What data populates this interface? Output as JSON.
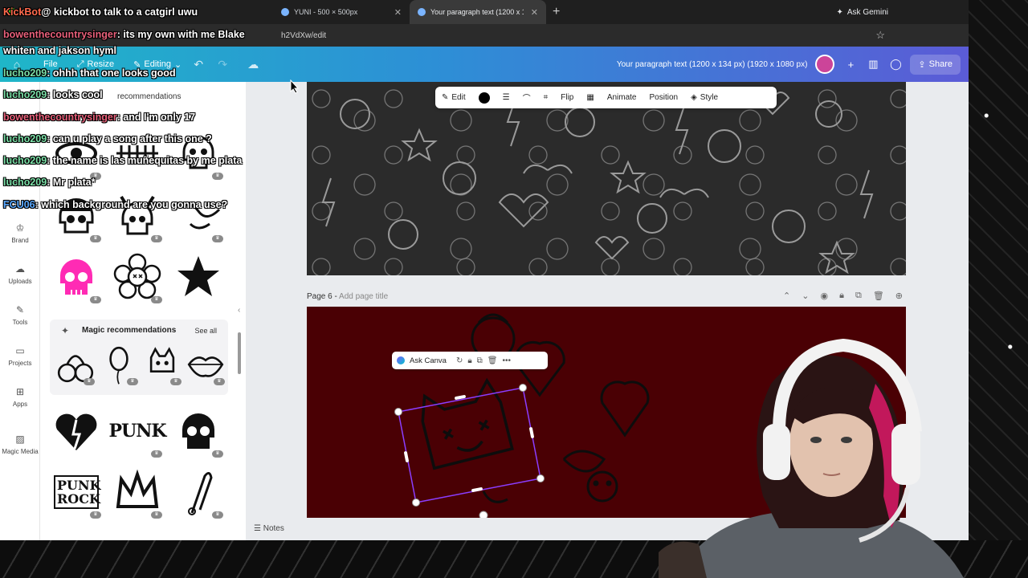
{
  "browser": {
    "tabs": [
      {
        "label": "",
        "active": false
      },
      {
        "label": "YUNI - 500 × 500px",
        "active": false
      },
      {
        "label": "Your paragraph text (1200 x 134 px)",
        "active": true
      }
    ],
    "ask_gemini": "Ask Gemini",
    "url_fragment": "h2VdXw/edit"
  },
  "canva": {
    "file_label": "File",
    "resize_label": "Resize",
    "editing_label": "Editing",
    "doc_title": "Your paragraph text (1200 x 134 px) (1920 x 1080 px)",
    "share_label": "Share"
  },
  "rail": {
    "items": [
      {
        "label": "Brand",
        "icon": "brand-icon"
      },
      {
        "label": "Uploads",
        "icon": "uploads-icon"
      },
      {
        "label": "Tools",
        "icon": "tools-icon"
      },
      {
        "label": "Projects",
        "icon": "projects-icon"
      },
      {
        "label": "Apps",
        "icon": "apps-icon"
      },
      {
        "label": "Magic Media",
        "icon": "magic-media-icon"
      }
    ]
  },
  "panel": {
    "header": "recommendations",
    "magic_title": "Magic recommendations",
    "see_all": "See all",
    "stickers_row2": [
      "punk-heart-sticker",
      "punk-text-sticker",
      "skull-sticker"
    ],
    "stickers_row3": [
      "punk-rock-text-sticker",
      "crown-sticker",
      "safety-pin-sticker"
    ],
    "punk_text": "PUNK",
    "punk_rock_text": "PUNK ROCK"
  },
  "element_toolbar": {
    "edit": "Edit",
    "flip": "Flip",
    "animate": "Animate",
    "position": "Position",
    "style": "Style"
  },
  "workspace": {
    "page6_label": "Page 6 - ",
    "page6_placeholder": "Add page title",
    "notes": "Notes",
    "ask_canva": "Ask Canva"
  },
  "chat": [
    {
      "user": "",
      "text": "@ kickbot to talk to a catgirl uwu"
    },
    {
      "user": "bowenthecountrysinger",
      "text": ": its my own with me Blake"
    },
    {
      "user": "",
      "text": "whiten and jakson hyml"
    },
    {
      "user": "lucho209",
      "text": ": ohhh that one looks good"
    },
    {
      "user": "lucho209",
      "text": ": looks cool"
    },
    {
      "user": "bowenthecountrysinger",
      "text": ": and I'm only 17"
    },
    {
      "user": "lucho209",
      "text": ": can u play a song after this one ?"
    },
    {
      "user": "lucho209",
      "text": ": the name is las muñequitas by me plata"
    },
    {
      "user": "lucho209",
      "text": ": Mr plata*"
    },
    {
      "user": "FCU06",
      "text": ": which background are you gonna use?"
    }
  ],
  "colors": {
    "canva_gradient_start": "#1fb6c8",
    "canva_gradient_end": "#5b5bd6",
    "page6_bg": "#4a0004",
    "selection": "#8b3dff"
  }
}
